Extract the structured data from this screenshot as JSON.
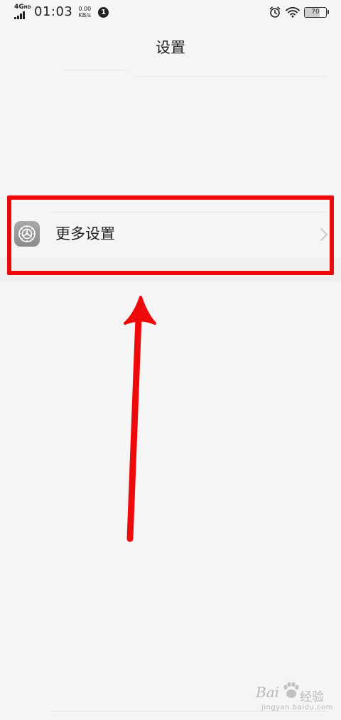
{
  "status_bar": {
    "network": "4G",
    "network_hd": "HD",
    "time": "01:03",
    "speed_value": "0.00",
    "speed_unit": "KB/s",
    "notification_count": "1",
    "battery_level": "70",
    "icons": [
      "signal-icon",
      "alarm-icon",
      "wifi-icon",
      "battery-icon"
    ]
  },
  "header": {
    "title": "设置"
  },
  "settings_list": {
    "items": [
      {
        "label": "更多设置",
        "icon": "gear-icon",
        "trailing": "chevron-right-icon"
      }
    ]
  },
  "annotation": {
    "box_color": "#ee0a0a",
    "arrow_color": "#ee0a0a"
  },
  "watermark": {
    "brand": "Bai",
    "brand_cn": "经验",
    "url": "jingyan.baidu.com"
  }
}
